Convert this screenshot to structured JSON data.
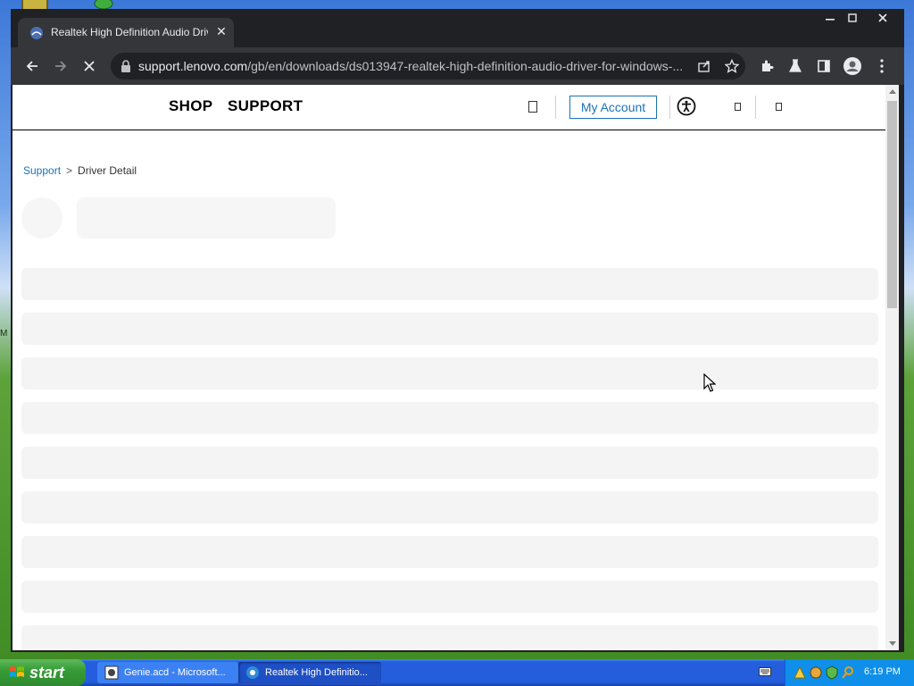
{
  "browser": {
    "tab_title": "Realtek High Definition Audio Driver",
    "url_host": "support.lenovo.com",
    "url_path": "/gb/en/downloads/ds013947-realtek-high-definition-audio-driver-for-windows-..."
  },
  "site": {
    "nav_shop": "SHOP",
    "nav_support": "SUPPORT",
    "account_label": "My Account"
  },
  "breadcrumb": {
    "link": "Support",
    "separator": ">",
    "current": "Driver Detail"
  },
  "desktop": {
    "edge_letter": "M"
  },
  "taskbar": {
    "start_label": "start",
    "tasks": [
      {
        "label": "Genie.acd - Microsoft..."
      },
      {
        "label": "Realtek High Definitio..."
      }
    ],
    "clock": "6:19 PM"
  },
  "colors": {
    "link_blue": "#1a73b8",
    "browser_dark": "#202124",
    "skeleton": "#f4f4f4",
    "taskbar_blue": "#245edc",
    "start_green": "#379d37"
  }
}
